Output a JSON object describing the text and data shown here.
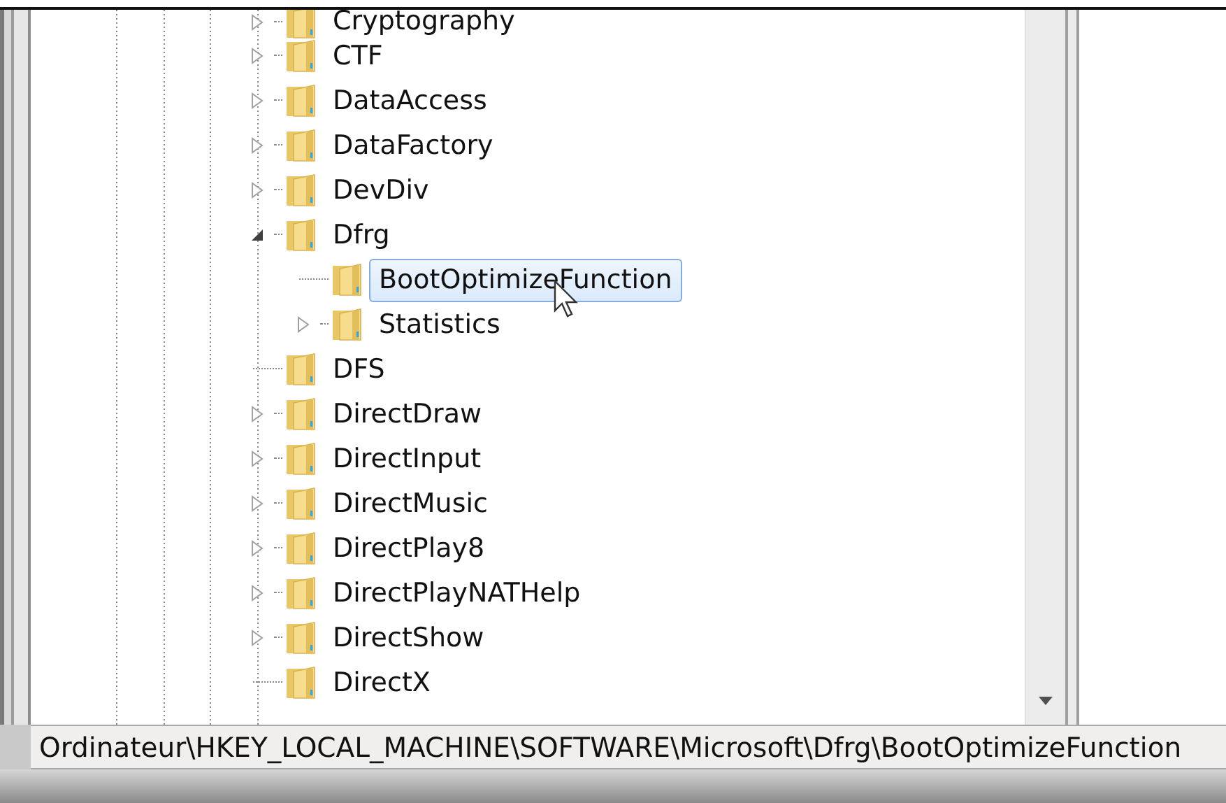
{
  "tree": [
    {
      "label": "Cryptography",
      "expanded": false,
      "selected": false
    },
    {
      "label": "CTF",
      "expanded": false,
      "selected": false
    },
    {
      "label": "DataAccess",
      "expanded": false,
      "selected": false
    },
    {
      "label": "DataFactory",
      "expanded": false,
      "selected": false
    },
    {
      "label": "DevDiv",
      "expanded": false,
      "selected": false
    },
    {
      "label": "Dfrg",
      "expanded": true,
      "selected": false,
      "children": [
        {
          "label": "BootOptimizeFunction",
          "selected": true
        },
        {
          "label": "Statistics",
          "expanded": false,
          "selected": false
        }
      ]
    },
    {
      "label": "DFS",
      "selected": false
    },
    {
      "label": "DirectDraw",
      "expanded": false,
      "selected": false
    },
    {
      "label": "DirectInput",
      "expanded": false,
      "selected": false
    },
    {
      "label": "DirectMusic",
      "expanded": false,
      "selected": false
    },
    {
      "label": "DirectPlay8",
      "expanded": false,
      "selected": false
    },
    {
      "label": "DirectPlayNATHelp",
      "expanded": false,
      "selected": false
    },
    {
      "label": "DirectShow",
      "expanded": false,
      "selected": false
    },
    {
      "label": "DirectX",
      "selected": false
    }
  ],
  "status_bar": "Ordinateur\\HKEY_LOCAL_MACHINE\\SOFTWARE\\Microsoft\\Dfrg\\BootOptimizeFunction"
}
